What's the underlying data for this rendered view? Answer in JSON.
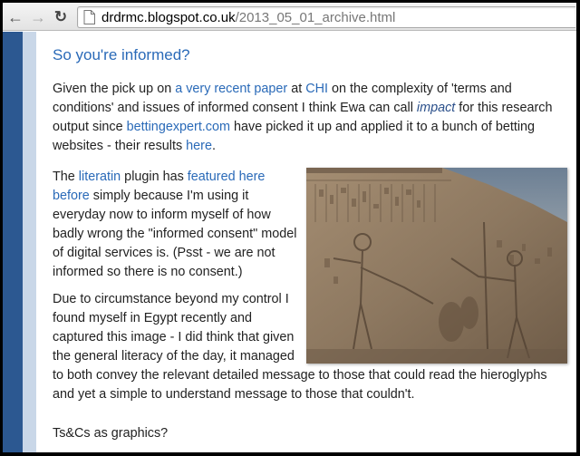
{
  "browser": {
    "url_host": "drdrmc.blogspot.co.uk",
    "url_path": "/2013_05_01_archive.html",
    "back_icon": "arrow-left",
    "forward_icon": "arrow-right",
    "reload_icon": "reload",
    "page_icon": "document"
  },
  "post": {
    "title": "So you're informed?",
    "p1": {
      "t1": "Given the pick up on ",
      "link_paper": "a very recent paper",
      "t2": " at ",
      "link_chi": "CHI",
      "t3": " on the complexity of 'terms and conditions' and issues of informed consent I think Ewa can call ",
      "link_impact": "impact",
      "t4": " for this research output since ",
      "link_bettingexpert": "bettingexpert.com",
      "t5": " have picked it up and applied it to a bunch of betting websites - their results ",
      "link_here": "here",
      "t6": "."
    },
    "p2": {
      "t1": "The ",
      "link_literatin": "literatin",
      "t2": " plugin has ",
      "link_featured": "featured here before",
      "t3": " simply because I'm using it everyday now to inform myself of how badly wrong the \"informed consent\" model of digital services is. (Psst - we are not informed so there is no consent.)"
    },
    "p3": "Due to circumstance beyond my control I found myself in Egypt recently and captured this image - I did think that given the general literacy of the day, it managed to both convey the relevant detailed message to those that could read the hieroglyphs and yet a  simple to understand message to those that couldn't.",
    "p4": "Ts&Cs as graphics?"
  },
  "colors": {
    "title": "#4a7fbf",
    "link": "#2a6ab8",
    "band_dark": "#2c5891",
    "band_light": "#c9d7e8"
  }
}
